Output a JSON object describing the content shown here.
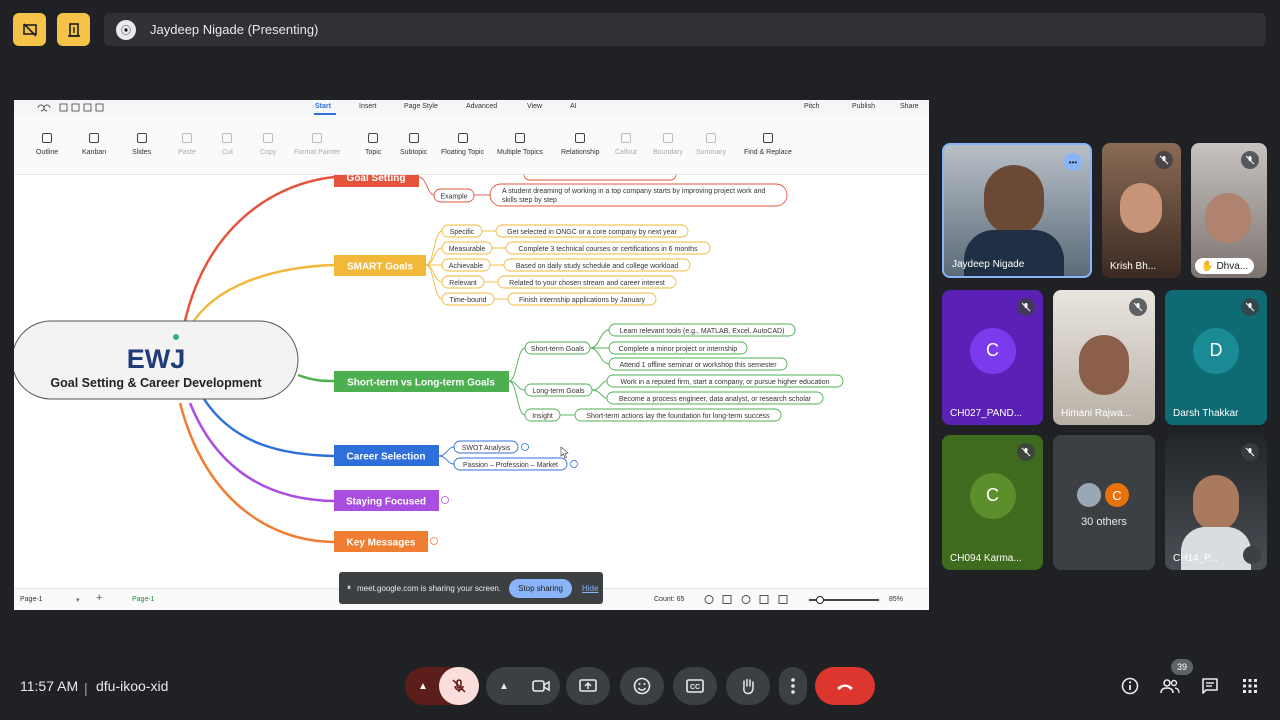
{
  "presenter": {
    "avatar_letter": "⦿",
    "label": "Jaydeep Nigade (Presenting)"
  },
  "app": {
    "menu": {
      "tabs": [
        "Start",
        "Insert",
        "Page Style",
        "Advanced",
        "View",
        "AI"
      ],
      "active": "Start",
      "pitch": "Pitch",
      "publish": "Publish",
      "share": "Share"
    },
    "ribbon": [
      "Outline",
      "Kanban",
      "Slides",
      "Paste",
      "Cut",
      "Copy",
      "Format Painter",
      "Topic",
      "Subtopic",
      "Floating Topic",
      "Multiple Topics",
      "Relationship",
      "Callout",
      "Boundary",
      "Summary",
      "Find & Replace"
    ],
    "status": {
      "page_select": "Page-1",
      "page_tab": "Page-1",
      "count": "Count: 65",
      "zoom": "85%"
    }
  },
  "mindmap": {
    "central": {
      "logo": "EWJ",
      "title": "Goal Setting & Career Development"
    },
    "branches": [
      {
        "label": "Goal Setting",
        "color": "#e5533d"
      },
      {
        "label": "SMART Goals",
        "color": "#f1b83a"
      },
      {
        "label": "Short-term vs Long-term Goals",
        "color": "#4caf50"
      },
      {
        "label": "Career Selection",
        "color": "#2f6fdb"
      },
      {
        "label": "Staying Focused",
        "color": "#a94ee0"
      },
      {
        "label": "Key Messages",
        "color": "#ef7d32"
      }
    ],
    "goal_setting": {
      "example_label": "Example",
      "example_text_1": "A student dreaming of working in a top company starts by improving project work and",
      "example_text_2": "skills step by step"
    },
    "smart": [
      {
        "label": "Specific",
        "text": "Get selected in ONGC or a core company by next year"
      },
      {
        "label": "Measurable",
        "text": "Complete 3 technical courses or certifications in 6 months"
      },
      {
        "label": "Achievable",
        "text": "Based on daily study schedule and college workload"
      },
      {
        "label": "Relevant",
        "text": "Related to your chosen stream and career interest"
      },
      {
        "label": "Time-bound",
        "text": "Finish internship applications by January"
      }
    ],
    "short_long": {
      "short_label": "Short-term Goals",
      "short_items": [
        "Learn relevant tools (e.g., MATLAB, Excel, AutoCAD)",
        "Complete a minor project or internship",
        "Attend 1 offline seminar or workshop this semester"
      ],
      "long_label": "Long-term Goals",
      "long_items": [
        "Work in a reputed firm, start a company, or pursue higher education",
        "Become a process engineer, data analyst, or research scholar"
      ],
      "insight_label": "Insight",
      "insight_text": "Short-term actions lay the foundation for long-term success"
    },
    "career": [
      "SWOT Analysis",
      "Passion – Profession – Market"
    ]
  },
  "share_notice": {
    "text": "meet.google.com is sharing your screen.",
    "stop": "Stop sharing",
    "hide": "Hide"
  },
  "participants": [
    {
      "name": "Jaydeep Nigade"
    },
    {
      "name": "Krish Bh..."
    },
    {
      "name": "Dhva..."
    },
    {
      "name": "CH027_PAND...",
      "letter": "C",
      "color": "#5b21b6"
    },
    {
      "name": "Himani Rajwa..."
    },
    {
      "name": "Darsh Thakkar",
      "letter": "D",
      "color": "#0e6b73"
    },
    {
      "name": "CH094 Karma...",
      "letter": "C",
      "color": "#3f6b1e"
    },
    {
      "others": "30 others",
      "letter": "C"
    },
    {
      "name": "CH14_P..."
    }
  ],
  "footer": {
    "time": "11:57 AM",
    "meeting_code": "dfu-ikoo-xid",
    "people_count": "39"
  }
}
